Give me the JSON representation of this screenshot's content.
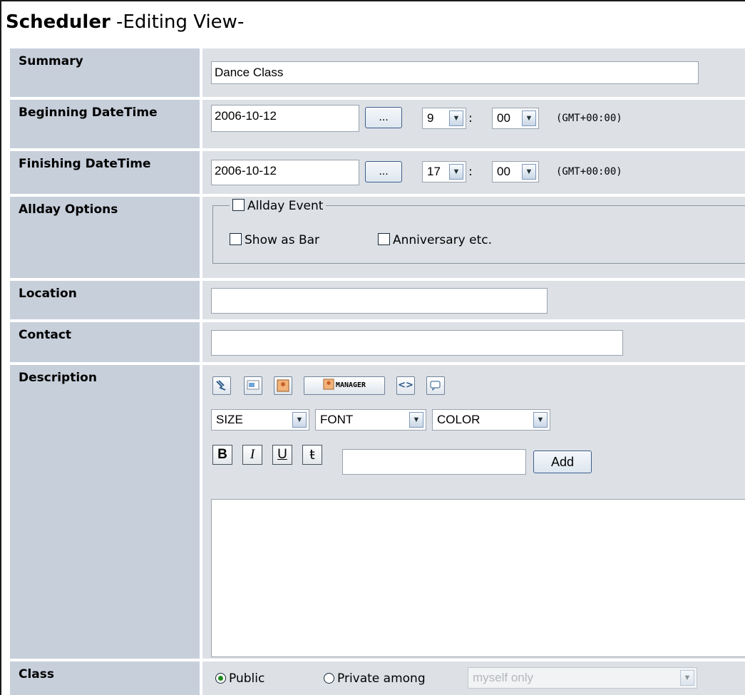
{
  "title": {
    "strong": "Scheduler",
    "sub": " -Editing View-"
  },
  "rows": {
    "summary": {
      "label": "Summary",
      "value": "Dance Class"
    },
    "begin": {
      "label": "Beginning DateTime",
      "date": "2006-10-12",
      "picker": "...",
      "hour": "9",
      "minute": "00",
      "tz": "(GMT+00:00)"
    },
    "finish": {
      "label": "Finishing DateTime",
      "date": "2006-10-12",
      "picker": "...",
      "hour": "17",
      "minute": "00",
      "tz": "(GMT+00:00)"
    },
    "allday": {
      "label": "Allday Options",
      "legend": "Allday Event",
      "show_bar": "Show as Bar",
      "anniversary": "Anniversary etc."
    },
    "location": {
      "label": "Location",
      "value": ""
    },
    "contact": {
      "label": "Contact",
      "value": ""
    },
    "description": {
      "label": "Description",
      "toolbar": {
        "manager": "MANAGER"
      },
      "size": "SIZE",
      "font": "FONT",
      "color": "COLOR",
      "bold": "B",
      "italic": "I",
      "underline": "U",
      "strike": "ŧ",
      "add": "Add",
      "text": ""
    },
    "class": {
      "label": "Class",
      "public": "Public",
      "private": "Private among",
      "private_select": "myself only"
    }
  }
}
